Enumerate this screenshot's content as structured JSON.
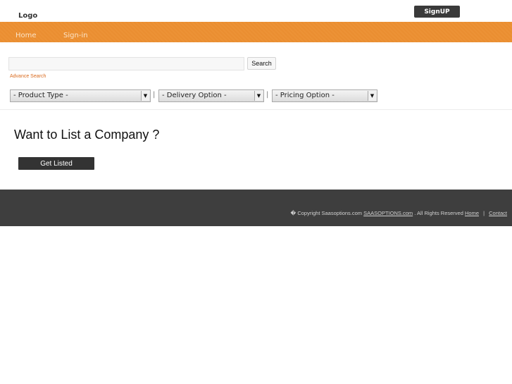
{
  "header": {
    "logo_text": "Logo",
    "signup_label": "SignUP"
  },
  "nav": {
    "home_label": "Home",
    "signin_label": "Sign-in"
  },
  "search": {
    "input_value": "",
    "button_label": "Search",
    "advance_link": "Advance Search"
  },
  "filters": {
    "product_type": "- Product Type -",
    "delivery_option": "- Delivery Option -",
    "pricing_option": "- Pricing Option -",
    "separator": "|"
  },
  "main": {
    "heading": "Want to List a Company ?",
    "cta_label": "Get Listed"
  },
  "footer": {
    "copyright_text": "� Copyright Saasoptions.com",
    "site_link": "SAASOPTIONS.com",
    "rights_text": ". All Rights Reserved",
    "home_link": "Home",
    "separator": "|",
    "contact_link": "Contact"
  },
  "colors": {
    "nav_orange": "#ec9236",
    "link_orange": "#d96a1d",
    "dark_button": "#333333",
    "footer_bg": "#3e3e3e"
  }
}
